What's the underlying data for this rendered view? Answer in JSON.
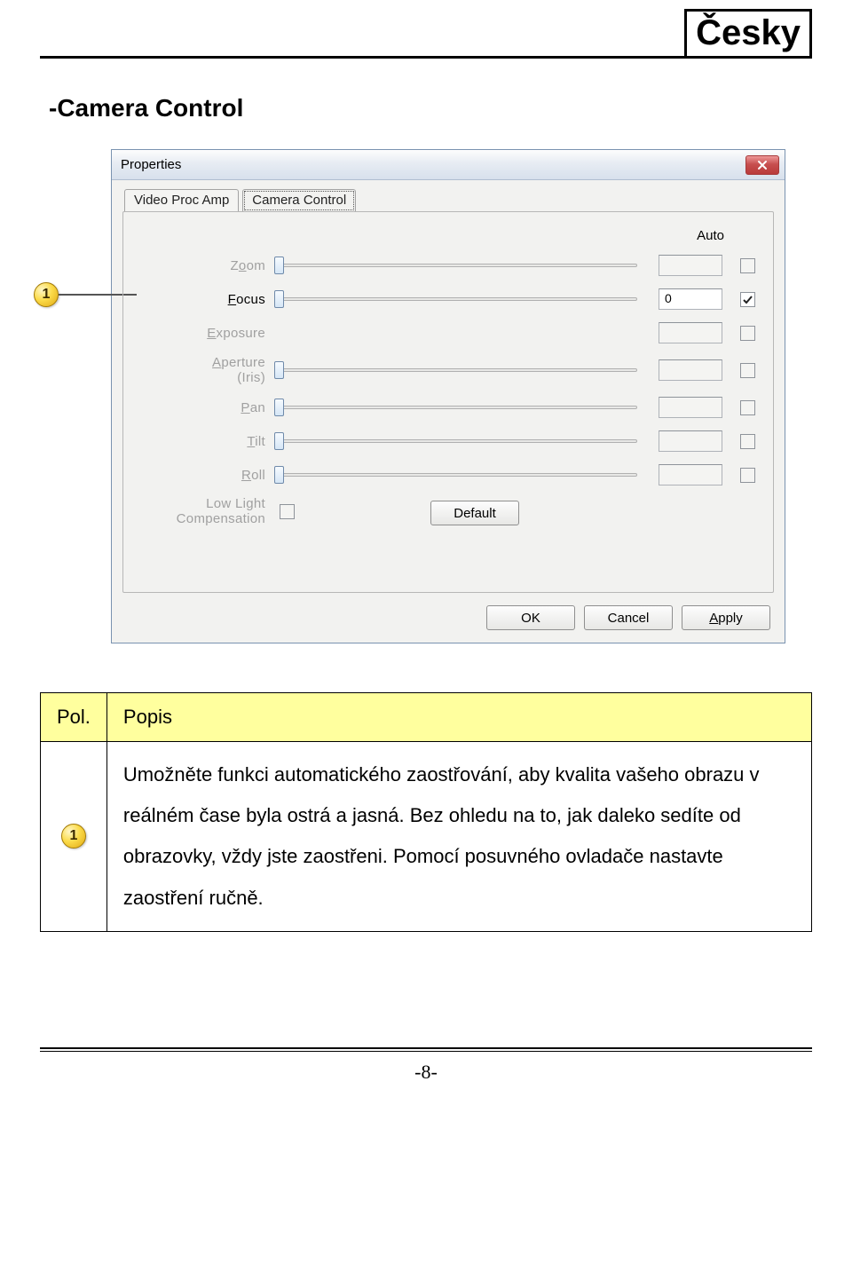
{
  "lang_badge": "Česky",
  "section_title": "-Camera Control",
  "dialog": {
    "title": "Properties",
    "tabs": {
      "video": "Video Proc Amp",
      "camera": "Camera Control"
    },
    "auto_header": "Auto",
    "rows": {
      "zoom": {
        "pre": "Z",
        "u": "o",
        "post": "om"
      },
      "focus": {
        "pre": "",
        "u": "F",
        "post": "ocus",
        "value": "0"
      },
      "exposure": {
        "pre": "",
        "u": "E",
        "post": "xposure"
      },
      "aperture": {
        "pre": "",
        "u": "A",
        "post": "perture",
        "sub": "(Iris)"
      },
      "pan": {
        "pre": "",
        "u": "P",
        "post": "an"
      },
      "tilt": {
        "pre": "",
        "u": "T",
        "post": "ilt"
      },
      "roll": {
        "pre": "",
        "u": "R",
        "post": "oll"
      },
      "llc": {
        "line1": "Low Light",
        "line2": "Compensation"
      }
    },
    "buttons": {
      "default": "Default",
      "ok": "OK",
      "cancel": "Cancel",
      "apply_pre": "",
      "apply_u": "A",
      "apply_post": "pply"
    }
  },
  "callout_num": "1",
  "table": {
    "h1": "Pol.",
    "h2": "Popis",
    "desc": "Umožněte funkci automatického zaostřování, aby kvalita vašeho obrazu v reálném čase byla ostrá a jasná. Bez ohledu na to, jak daleko sedíte od obrazovky, vždy jste zaostřeni. Pomocí posuvného ovladače nastavte zaostření ručně."
  },
  "page_number": "-8-"
}
